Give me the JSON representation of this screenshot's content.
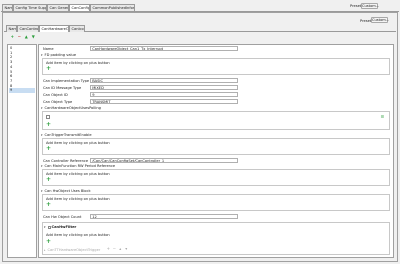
{
  "top_tabs": [
    "Name",
    "Config Time Support",
    "Can General",
    "CanConfigSet",
    "CommonPublishedInformation"
  ],
  "top_active": 3,
  "preset_label": "Preset",
  "custom_label": "Custom...",
  "sub_tabs": [
    "Name",
    "CanController",
    "CanHardwareObject",
    "CanIcom"
  ],
  "sub_active": 2,
  "list_items": [
    "0",
    "1",
    "2",
    "3",
    "4",
    "5",
    "6",
    "7",
    "8",
    "9"
  ],
  "list_selected": 9,
  "toolbar_icons": [
    "add-icon",
    "remove-icon",
    "move-up-icon",
    "move-down-icon"
  ],
  "name_label": "Name",
  "name_value": "CanHardwareObject_Can1_Tx_Interrupt",
  "sections": {
    "fd_padding": "FD padding value",
    "hw_object_uses_polling": "CanHardwareObjectUsesPolling",
    "trigger_transmit": "CanTriggerTransmitEnable",
    "mainfunction_rw": "Can MainFunction RW Period Reference",
    "hw_object_uses_block": "Can HwObject Uses Block",
    "hw_filter": "CanHwFilter",
    "ttcan": "CanTTHardwareObjectTrigger"
  },
  "add_item_hint": "Add item by clicking on plus button",
  "fields": {
    "impl_type_label": "Can Implementation Type",
    "impl_type_value": "BASIC",
    "id_msg_type_label": "Can ID Message Type",
    "id_msg_type_value": "MIXED",
    "object_id_label": "Can Object ID",
    "object_id_value": "9",
    "object_type_label": "Can Object Type",
    "object_type_value": "TRANSMIT",
    "controller_ref_label": "Can Controller Reference",
    "controller_ref_value": "/Can/Can/CanConfigSet/CanController_1",
    "hw_object_count_label": "Can Hw Object Count",
    "hw_object_count_value": "12"
  }
}
